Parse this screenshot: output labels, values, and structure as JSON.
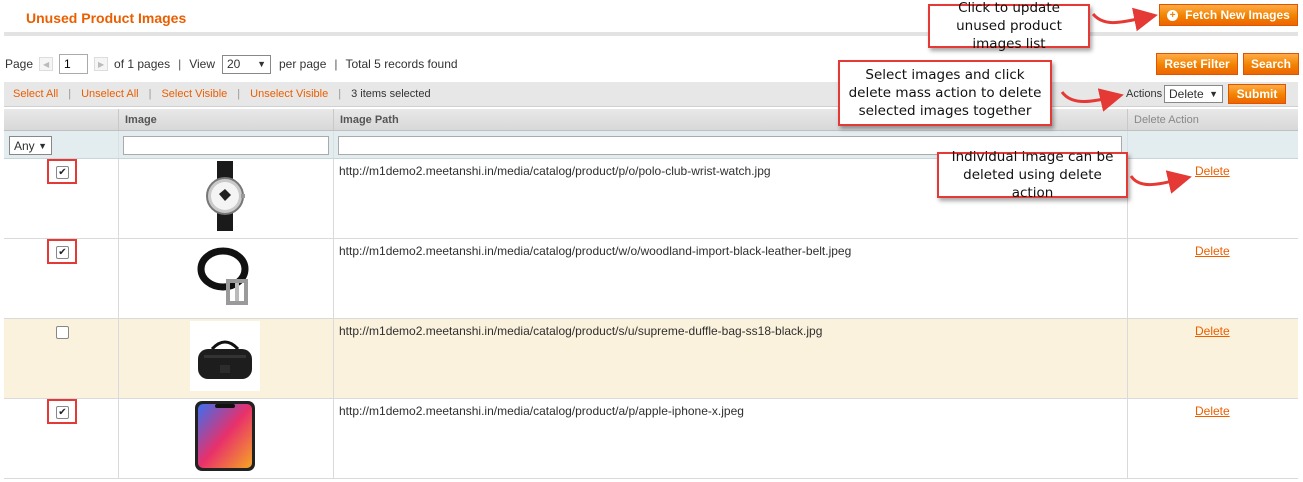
{
  "header": {
    "title": "Unused Product Images",
    "fetch_label": "Fetch New Images"
  },
  "pager": {
    "page_label": "Page",
    "page_value": "1",
    "of_pages": "of 1 pages",
    "view_label": "View",
    "view_value": "20",
    "per_page": "per page",
    "total": "Total 5 records found"
  },
  "filter_buttons": {
    "reset": "Reset Filter",
    "search": "Search"
  },
  "massaction": {
    "select_all": "Select All",
    "unselect_all": "Unselect All",
    "select_visible": "Select Visible",
    "unselect_visible": "Unselect Visible",
    "selected_count": "3 items selected",
    "actions_label": "Actions",
    "actions_value": "Delete",
    "submit": "Submit"
  },
  "columns": {
    "image": "Image",
    "image_path": "Image Path",
    "delete_action": "Delete Action"
  },
  "filters": {
    "checkbox_filter": "Any"
  },
  "rows": [
    {
      "checked": true,
      "path": "http://m1demo2.meetanshi.in/media/catalog/product/p/o/polo-club-wrist-watch.jpg",
      "action": "Delete",
      "image": "wrist-watch"
    },
    {
      "checked": true,
      "path": "http://m1demo2.meetanshi.in/media/catalog/product/w/o/woodland-import-black-leather-belt.jpeg",
      "action": "Delete",
      "image": "leather-belt"
    },
    {
      "checked": false,
      "path": "http://m1demo2.meetanshi.in/media/catalog/product/s/u/supreme-duffle-bag-ss18-black.jpg",
      "action": "Delete",
      "image": "duffle-bag"
    },
    {
      "checked": true,
      "path": "http://m1demo2.meetanshi.in/media/catalog/product/a/p/apple-iphone-x.jpeg",
      "action": "Delete",
      "image": "iphone"
    }
  ],
  "callouts": {
    "fetch": "Click to update unused product images list",
    "mass": "Select images and click delete mass action to delete selected images together",
    "single": "Individual image can be deleted using delete action"
  },
  "colors": {
    "accent": "#eb5e00",
    "button": "#f18200",
    "highlight": "#e53935",
    "odd_row": "#fbf2dd"
  }
}
